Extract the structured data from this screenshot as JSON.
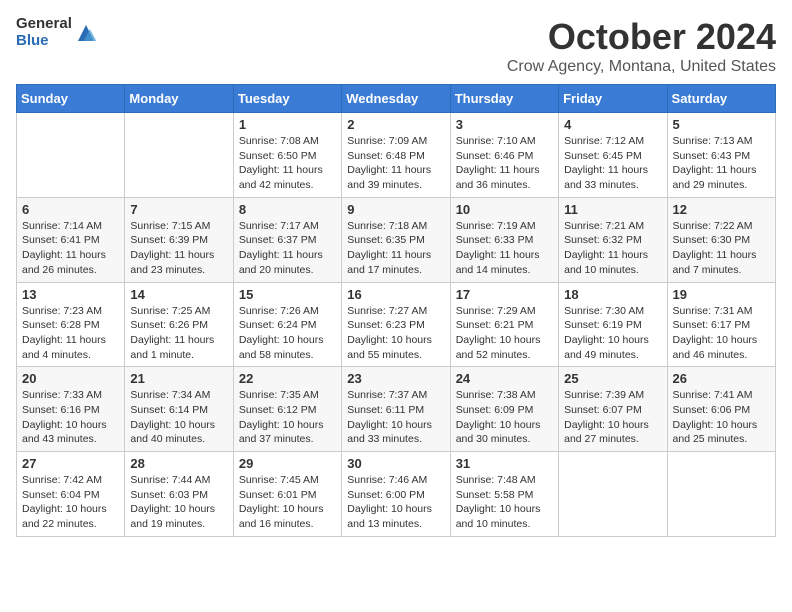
{
  "logo": {
    "general": "General",
    "blue": "Blue"
  },
  "title": "October 2024",
  "location": "Crow Agency, Montana, United States",
  "days_of_week": [
    "Sunday",
    "Monday",
    "Tuesday",
    "Wednesday",
    "Thursday",
    "Friday",
    "Saturday"
  ],
  "weeks": [
    [
      {
        "day": "",
        "sunrise": "",
        "sunset": "",
        "daylight": ""
      },
      {
        "day": "",
        "sunrise": "",
        "sunset": "",
        "daylight": ""
      },
      {
        "day": "1",
        "sunrise": "Sunrise: 7:08 AM",
        "sunset": "Sunset: 6:50 PM",
        "daylight": "Daylight: 11 hours and 42 minutes."
      },
      {
        "day": "2",
        "sunrise": "Sunrise: 7:09 AM",
        "sunset": "Sunset: 6:48 PM",
        "daylight": "Daylight: 11 hours and 39 minutes."
      },
      {
        "day": "3",
        "sunrise": "Sunrise: 7:10 AM",
        "sunset": "Sunset: 6:46 PM",
        "daylight": "Daylight: 11 hours and 36 minutes."
      },
      {
        "day": "4",
        "sunrise": "Sunrise: 7:12 AM",
        "sunset": "Sunset: 6:45 PM",
        "daylight": "Daylight: 11 hours and 33 minutes."
      },
      {
        "day": "5",
        "sunrise": "Sunrise: 7:13 AM",
        "sunset": "Sunset: 6:43 PM",
        "daylight": "Daylight: 11 hours and 29 minutes."
      }
    ],
    [
      {
        "day": "6",
        "sunrise": "Sunrise: 7:14 AM",
        "sunset": "Sunset: 6:41 PM",
        "daylight": "Daylight: 11 hours and 26 minutes."
      },
      {
        "day": "7",
        "sunrise": "Sunrise: 7:15 AM",
        "sunset": "Sunset: 6:39 PM",
        "daylight": "Daylight: 11 hours and 23 minutes."
      },
      {
        "day": "8",
        "sunrise": "Sunrise: 7:17 AM",
        "sunset": "Sunset: 6:37 PM",
        "daylight": "Daylight: 11 hours and 20 minutes."
      },
      {
        "day": "9",
        "sunrise": "Sunrise: 7:18 AM",
        "sunset": "Sunset: 6:35 PM",
        "daylight": "Daylight: 11 hours and 17 minutes."
      },
      {
        "day": "10",
        "sunrise": "Sunrise: 7:19 AM",
        "sunset": "Sunset: 6:33 PM",
        "daylight": "Daylight: 11 hours and 14 minutes."
      },
      {
        "day": "11",
        "sunrise": "Sunrise: 7:21 AM",
        "sunset": "Sunset: 6:32 PM",
        "daylight": "Daylight: 11 hours and 10 minutes."
      },
      {
        "day": "12",
        "sunrise": "Sunrise: 7:22 AM",
        "sunset": "Sunset: 6:30 PM",
        "daylight": "Daylight: 11 hours and 7 minutes."
      }
    ],
    [
      {
        "day": "13",
        "sunrise": "Sunrise: 7:23 AM",
        "sunset": "Sunset: 6:28 PM",
        "daylight": "Daylight: 11 hours and 4 minutes."
      },
      {
        "day": "14",
        "sunrise": "Sunrise: 7:25 AM",
        "sunset": "Sunset: 6:26 PM",
        "daylight": "Daylight: 11 hours and 1 minute."
      },
      {
        "day": "15",
        "sunrise": "Sunrise: 7:26 AM",
        "sunset": "Sunset: 6:24 PM",
        "daylight": "Daylight: 10 hours and 58 minutes."
      },
      {
        "day": "16",
        "sunrise": "Sunrise: 7:27 AM",
        "sunset": "Sunset: 6:23 PM",
        "daylight": "Daylight: 10 hours and 55 minutes."
      },
      {
        "day": "17",
        "sunrise": "Sunrise: 7:29 AM",
        "sunset": "Sunset: 6:21 PM",
        "daylight": "Daylight: 10 hours and 52 minutes."
      },
      {
        "day": "18",
        "sunrise": "Sunrise: 7:30 AM",
        "sunset": "Sunset: 6:19 PM",
        "daylight": "Daylight: 10 hours and 49 minutes."
      },
      {
        "day": "19",
        "sunrise": "Sunrise: 7:31 AM",
        "sunset": "Sunset: 6:17 PM",
        "daylight": "Daylight: 10 hours and 46 minutes."
      }
    ],
    [
      {
        "day": "20",
        "sunrise": "Sunrise: 7:33 AM",
        "sunset": "Sunset: 6:16 PM",
        "daylight": "Daylight: 10 hours and 43 minutes."
      },
      {
        "day": "21",
        "sunrise": "Sunrise: 7:34 AM",
        "sunset": "Sunset: 6:14 PM",
        "daylight": "Daylight: 10 hours and 40 minutes."
      },
      {
        "day": "22",
        "sunrise": "Sunrise: 7:35 AM",
        "sunset": "Sunset: 6:12 PM",
        "daylight": "Daylight: 10 hours and 37 minutes."
      },
      {
        "day": "23",
        "sunrise": "Sunrise: 7:37 AM",
        "sunset": "Sunset: 6:11 PM",
        "daylight": "Daylight: 10 hours and 33 minutes."
      },
      {
        "day": "24",
        "sunrise": "Sunrise: 7:38 AM",
        "sunset": "Sunset: 6:09 PM",
        "daylight": "Daylight: 10 hours and 30 minutes."
      },
      {
        "day": "25",
        "sunrise": "Sunrise: 7:39 AM",
        "sunset": "Sunset: 6:07 PM",
        "daylight": "Daylight: 10 hours and 27 minutes."
      },
      {
        "day": "26",
        "sunrise": "Sunrise: 7:41 AM",
        "sunset": "Sunset: 6:06 PM",
        "daylight": "Daylight: 10 hours and 25 minutes."
      }
    ],
    [
      {
        "day": "27",
        "sunrise": "Sunrise: 7:42 AM",
        "sunset": "Sunset: 6:04 PM",
        "daylight": "Daylight: 10 hours and 22 minutes."
      },
      {
        "day": "28",
        "sunrise": "Sunrise: 7:44 AM",
        "sunset": "Sunset: 6:03 PM",
        "daylight": "Daylight: 10 hours and 19 minutes."
      },
      {
        "day": "29",
        "sunrise": "Sunrise: 7:45 AM",
        "sunset": "Sunset: 6:01 PM",
        "daylight": "Daylight: 10 hours and 16 minutes."
      },
      {
        "day": "30",
        "sunrise": "Sunrise: 7:46 AM",
        "sunset": "Sunset: 6:00 PM",
        "daylight": "Daylight: 10 hours and 13 minutes."
      },
      {
        "day": "31",
        "sunrise": "Sunrise: 7:48 AM",
        "sunset": "Sunset: 5:58 PM",
        "daylight": "Daylight: 10 hours and 10 minutes."
      },
      {
        "day": "",
        "sunrise": "",
        "sunset": "",
        "daylight": ""
      },
      {
        "day": "",
        "sunrise": "",
        "sunset": "",
        "daylight": ""
      }
    ]
  ]
}
